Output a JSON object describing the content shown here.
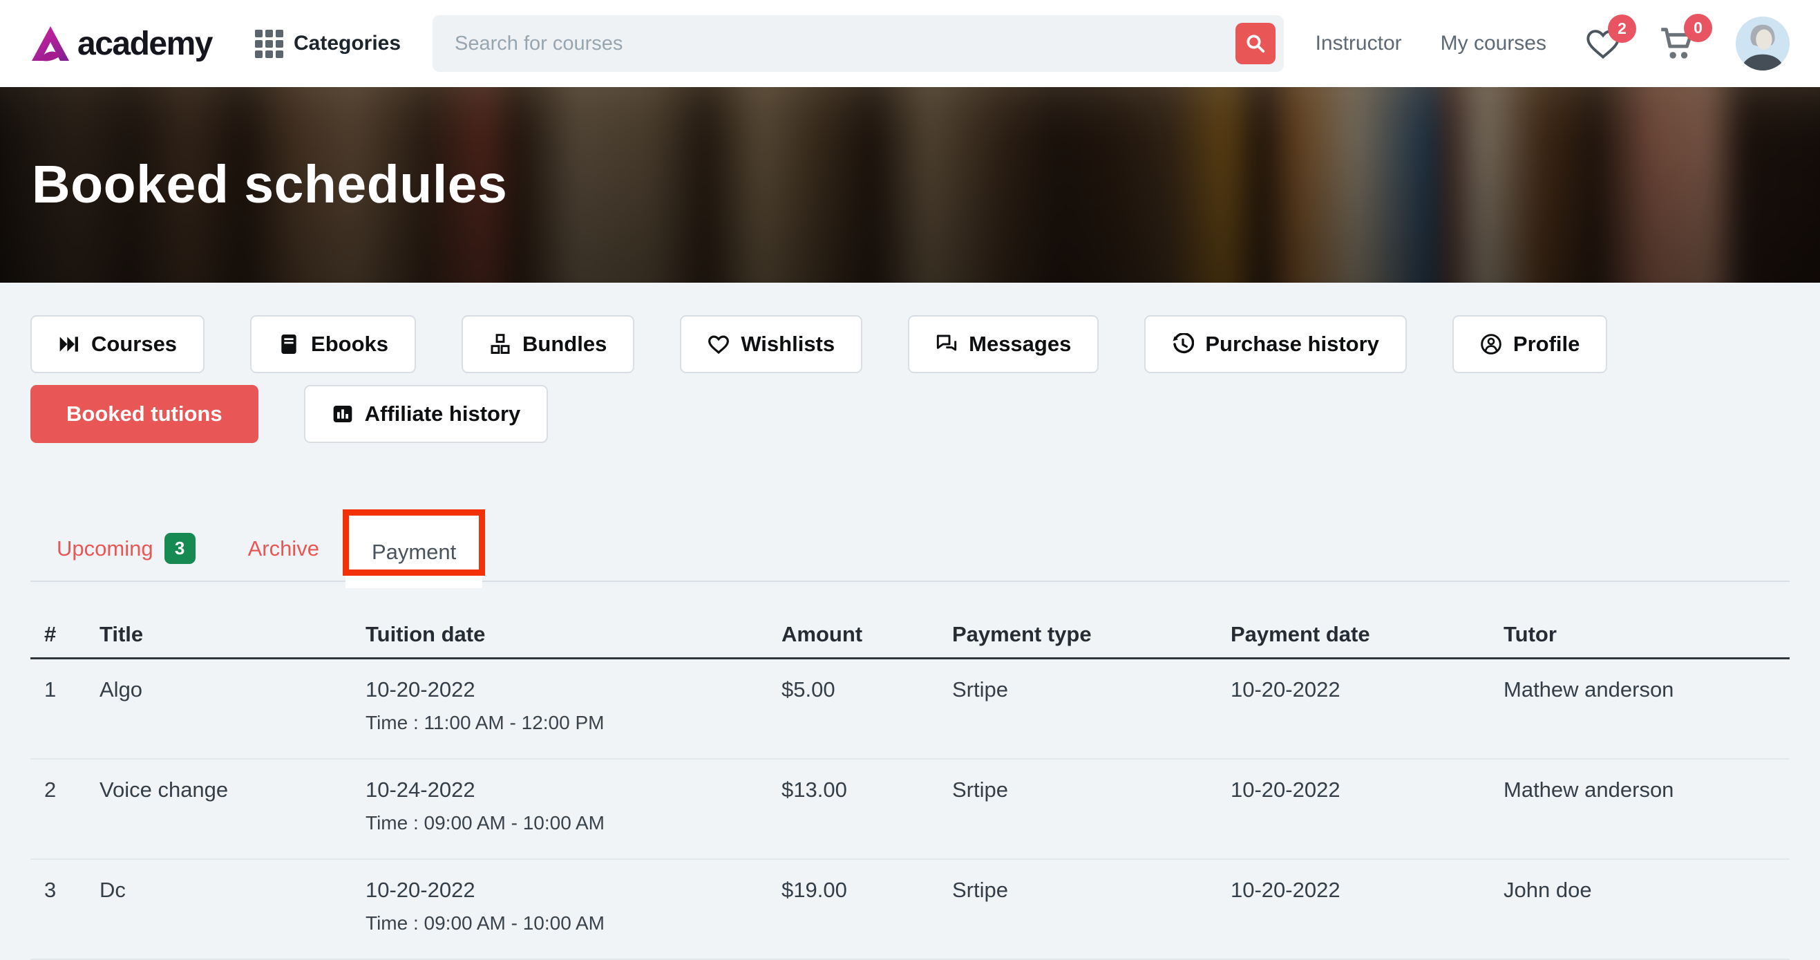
{
  "navbar": {
    "logo_text": "academy",
    "categories_label": "Categories",
    "search_placeholder": "Search for courses",
    "instructor_label": "Instructor",
    "my_courses_label": "My courses",
    "wishlist_badge": "2",
    "cart_badge": "0"
  },
  "hero": {
    "title": "Booked schedules"
  },
  "menu": {
    "items": [
      {
        "label": "Courses",
        "icon": "skip-forward-icon"
      },
      {
        "label": "Ebooks",
        "icon": "book-icon"
      },
      {
        "label": "Bundles",
        "icon": "boxes-icon"
      },
      {
        "label": "Wishlists",
        "icon": "heart-icon"
      },
      {
        "label": "Messages",
        "icon": "chat-icon"
      },
      {
        "label": "Purchase history",
        "icon": "history-icon"
      },
      {
        "label": "Profile",
        "icon": "person-circle-icon"
      },
      {
        "label": "Booked tutions",
        "active": true
      },
      {
        "label": "Affiliate history",
        "icon": "bar-chart-icon"
      }
    ]
  },
  "tabs": {
    "items": [
      {
        "label": "Upcoming",
        "badge": "3"
      },
      {
        "label": "Archive"
      },
      {
        "label": "Payment",
        "active": true,
        "annotated": true
      }
    ]
  },
  "table": {
    "columns": [
      "#",
      "Title",
      "Tuition date",
      "Amount",
      "Payment type",
      "Payment date",
      "Tutor"
    ],
    "rows": [
      {
        "num": "1",
        "title": "Algo",
        "tuition_date": "10-20-2022",
        "tuition_time": "Time : 11:00 AM - 12:00 PM",
        "amount": "$5.00",
        "payment_type": "Srtipe",
        "payment_date": "10-20-2022",
        "tutor": "Mathew anderson"
      },
      {
        "num": "2",
        "title": "Voice change",
        "tuition_date": "10-24-2022",
        "tuition_time": "Time : 09:00 AM - 10:00 AM",
        "amount": "$13.00",
        "payment_type": "Srtipe",
        "payment_date": "10-20-2022",
        "tutor": "Mathew anderson"
      },
      {
        "num": "3",
        "title": "Dc",
        "tuition_date": "10-20-2022",
        "tuition_time": "Time : 09:00 AM - 10:00 AM",
        "amount": "$19.00",
        "payment_type": "Srtipe",
        "payment_date": "10-20-2022",
        "tutor": "John doe"
      }
    ]
  },
  "colors": {
    "accent_red": "#e85755",
    "annotation_red": "#f23109",
    "badge_green": "#178a54",
    "badge_red": "#e85462",
    "navbar_bg": "#ffffff",
    "page_bg": "#f0f4f6"
  }
}
